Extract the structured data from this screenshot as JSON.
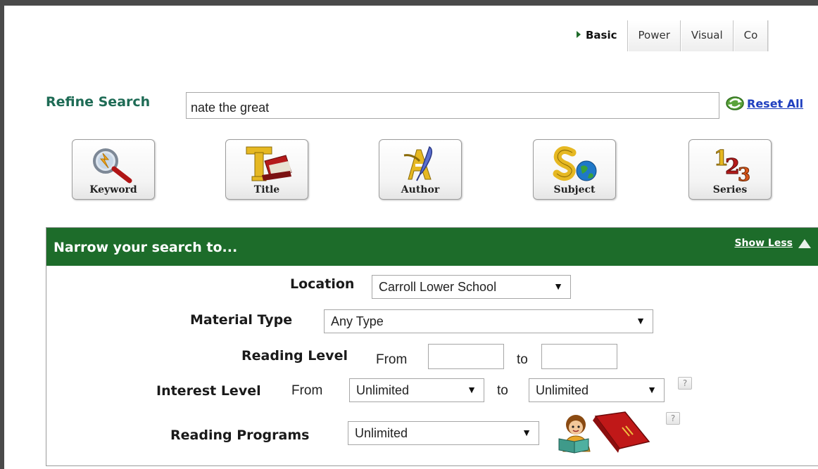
{
  "tabs": [
    {
      "label": "Basic",
      "active": true
    },
    {
      "label": "Power",
      "active": false
    },
    {
      "label": "Visual",
      "active": false
    },
    {
      "label": "Co",
      "active": false
    }
  ],
  "refine": {
    "label": "Refine Search",
    "query": "nate the great",
    "reset_label": "Reset All"
  },
  "search_types": [
    {
      "label": "Keyword",
      "icon": "magnifier-icon"
    },
    {
      "label": "Title",
      "icon": "title-book-icon"
    },
    {
      "label": "Author",
      "icon": "author-quill-icon"
    },
    {
      "label": "Subject",
      "icon": "subject-globe-icon"
    },
    {
      "label": "Series",
      "icon": "series-123-icon"
    }
  ],
  "narrow": {
    "title": "Narrow your search to...",
    "toggle_label": "Show Less",
    "location": {
      "label": "Location",
      "value": "Carroll Lower School"
    },
    "material_type": {
      "label": "Material Type",
      "value": "Any Type"
    },
    "reading_level": {
      "label": "Reading Level",
      "from_label": "From",
      "to_label": "to",
      "from_value": "",
      "to_value": ""
    },
    "interest_level": {
      "label": "Interest Level",
      "from_label": "From",
      "to_label": "to",
      "from_value": "Unlimited",
      "to_value": "Unlimited"
    },
    "reading_programs": {
      "label": "Reading Programs",
      "value": "Unlimited"
    },
    "help_glyph": "?"
  },
  "colors": {
    "header_green": "#1d6c2a",
    "refine_teal": "#1e6b55",
    "link_blue": "#1f3fbf"
  }
}
